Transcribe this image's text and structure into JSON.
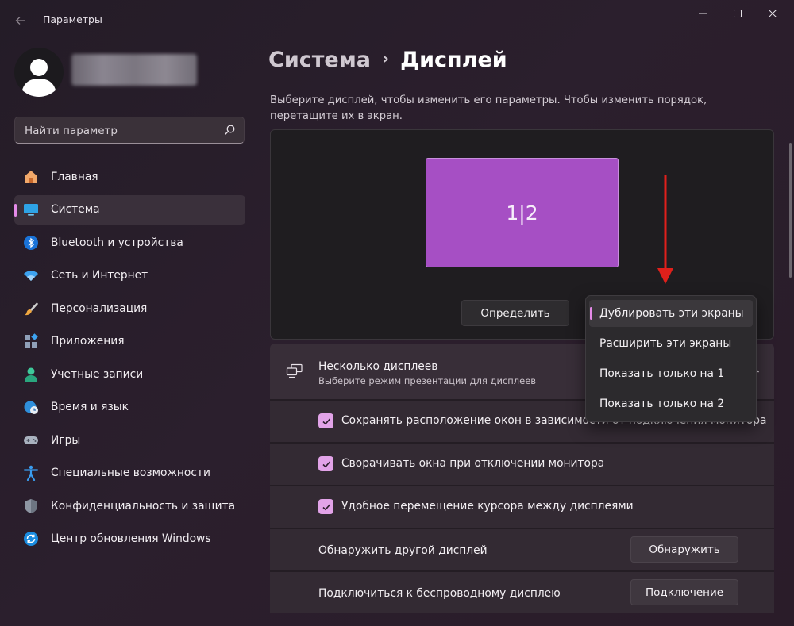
{
  "window": {
    "title": "Параметры"
  },
  "sidebar": {
    "search_placeholder": "Найти параметр",
    "items": [
      {
        "label": "Главная",
        "icon": "home-icon"
      },
      {
        "label": "Система",
        "icon": "monitor-icon",
        "active": true
      },
      {
        "label": "Bluetooth и устройства",
        "icon": "bluetooth-icon"
      },
      {
        "label": "Сеть и Интернет",
        "icon": "wifi-icon"
      },
      {
        "label": "Персонализация",
        "icon": "brush-icon"
      },
      {
        "label": "Приложения",
        "icon": "apps-icon"
      },
      {
        "label": "Учетные записи",
        "icon": "account-icon"
      },
      {
        "label": "Время и язык",
        "icon": "globe-clock-icon"
      },
      {
        "label": "Игры",
        "icon": "gamepad-icon"
      },
      {
        "label": "Специальные возможности",
        "icon": "accessibility-icon"
      },
      {
        "label": "Конфиденциальность и защита",
        "icon": "shield-icon"
      },
      {
        "label": "Центр обновления Windows",
        "icon": "update-icon"
      }
    ]
  },
  "breadcrumb": {
    "parent": "Система",
    "separator": "›",
    "current": "Дисплей"
  },
  "display": {
    "hint": "Выберите дисплей, чтобы изменить его параметры. Чтобы изменить порядок, перетащите их в экран.",
    "monitor_label": "1|2",
    "identify_label": "Определить"
  },
  "multiple_displays": {
    "title": "Несколько дисплеев",
    "subtitle": "Выберите режим презентации для дисплеев",
    "options": [
      {
        "label": "Сохранять расположение окон в зависимости от подключения монитора",
        "checked": true
      },
      {
        "label": "Сворачивать окна при отключении монитора",
        "checked": true
      },
      {
        "label": "Удобное перемещение курсора между дисплеями",
        "checked": true
      }
    ],
    "detect": {
      "label": "Обнаружить другой дисплей",
      "button": "Обнаружить"
    },
    "wireless": {
      "label": "Подключиться к беспроводному дисплею",
      "button": "Подключение"
    }
  },
  "dropdown": {
    "items": [
      {
        "label": "Дублировать эти экраны",
        "selected": true
      },
      {
        "label": "Расширить эти экраны"
      },
      {
        "label": "Показать только на 1"
      },
      {
        "label": "Показать только на 2"
      }
    ]
  },
  "colors": {
    "accent": "#e48ae8",
    "monitor": "#a64fc4",
    "arrow": "#e0201b"
  }
}
